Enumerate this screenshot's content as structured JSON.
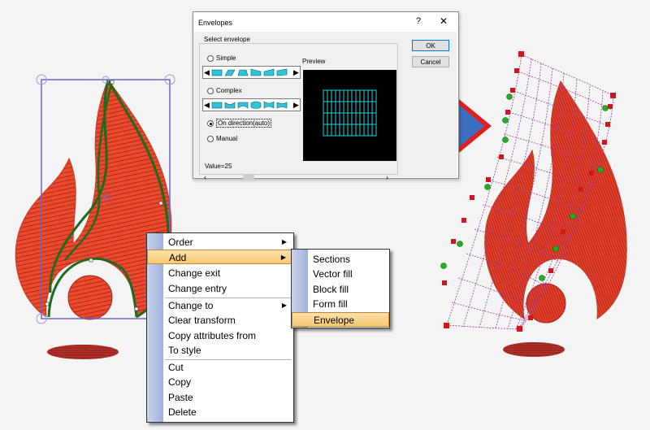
{
  "dialog": {
    "title": "Envelopes",
    "help": "?",
    "close": "✕",
    "group_label": "Select envelope",
    "preview_label": "Preview",
    "options": {
      "simple": "Simple",
      "complex": "Complex",
      "on_direction": "On direction(auto)",
      "manual": "Manual"
    },
    "selected_option": "on_direction",
    "value_label": "Value=25",
    "ok": "OK",
    "cancel": "Cancel"
  },
  "context_menu": {
    "items": [
      "Order",
      "Add",
      "Change exit",
      "Change entry",
      "Change to",
      "Clear transform",
      "Copy attributes from",
      "To style",
      "Cut",
      "Copy",
      "Paste",
      "Delete"
    ],
    "highlighted": "Add",
    "submenu_arrow": "▶"
  },
  "add_submenu": {
    "items": [
      "Sections",
      "Vector fill",
      "Block fill",
      "Form fill",
      "Envelope"
    ],
    "highlighted": "Envelope"
  },
  "colors": {
    "flame": "#e8472a",
    "flame_dark": "#b3261a",
    "selection": "#6a66c9",
    "outline_green": "#1e6a1e",
    "envelope_grid": "#9a3da8",
    "preview_grid": "#1fd3e0",
    "arrow_blue": "#3d6fc0",
    "arrow_red": "#e31e1e",
    "menu_highlight": "#f7c971"
  }
}
